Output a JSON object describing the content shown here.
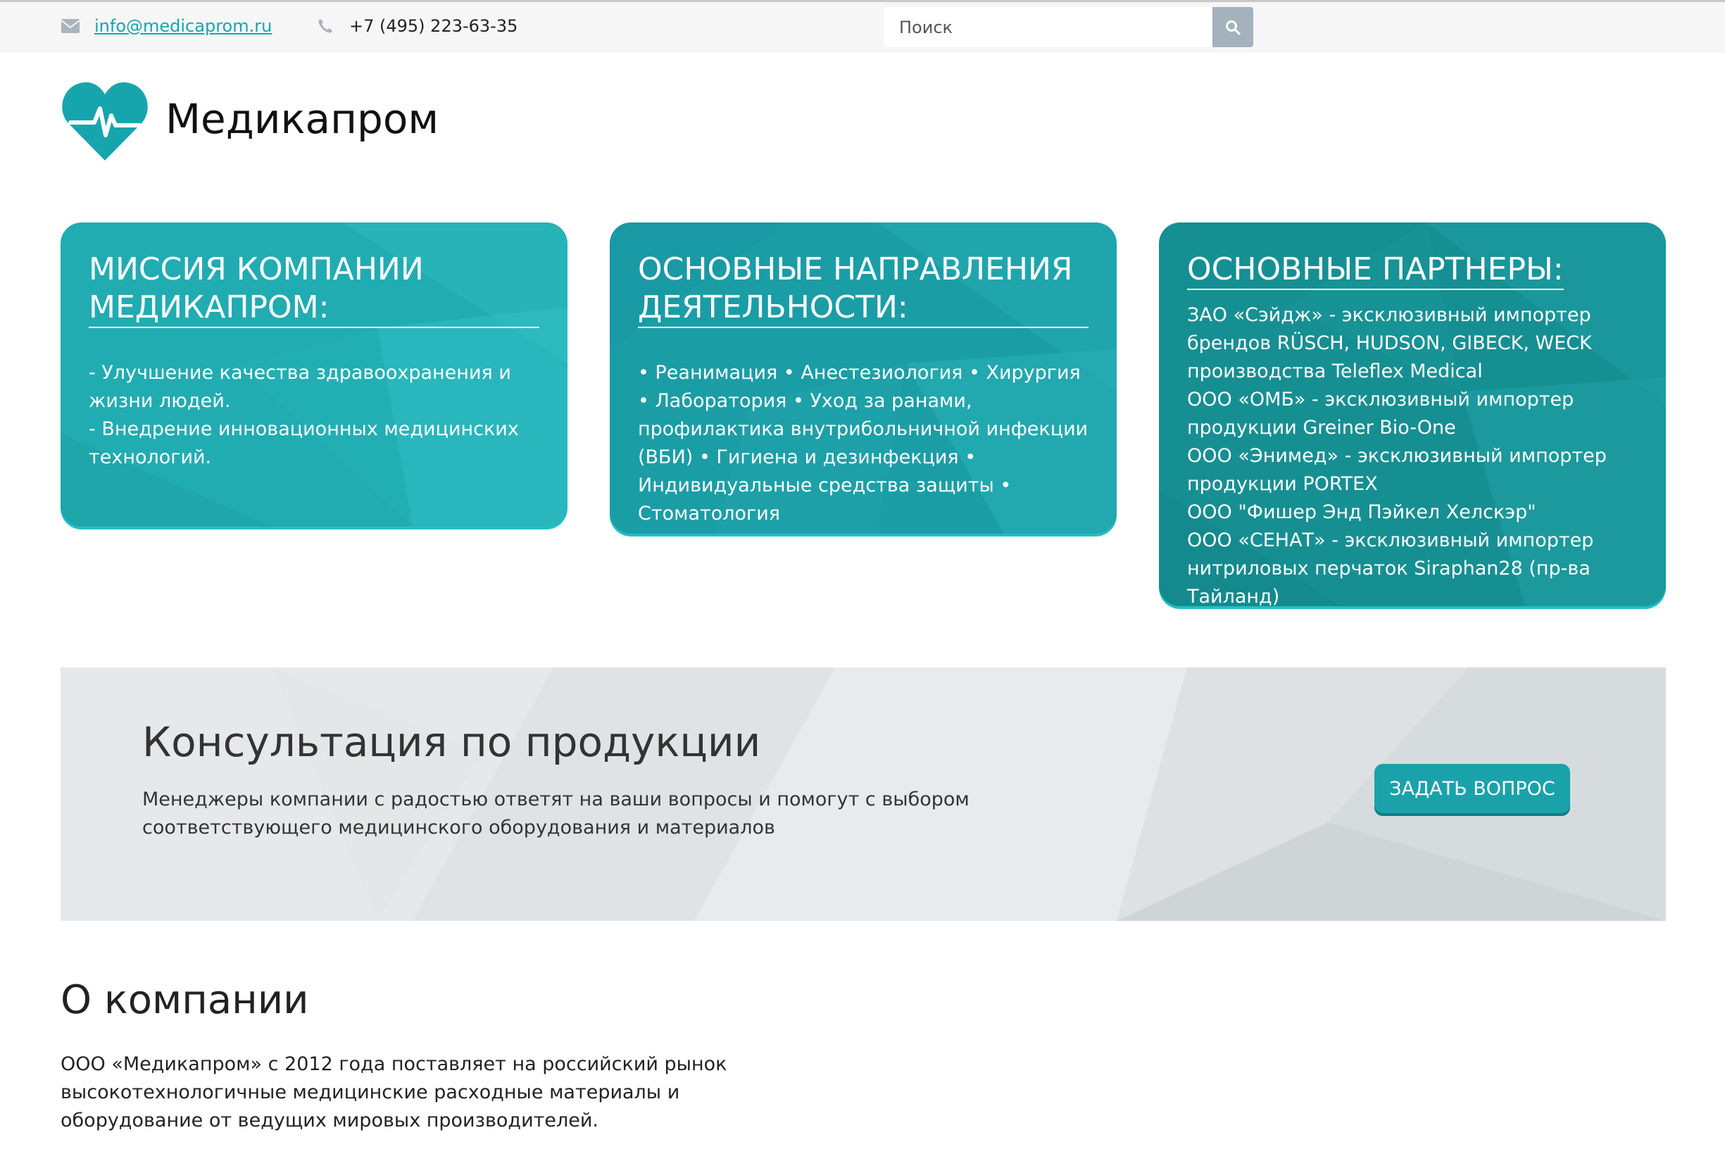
{
  "topbar": {
    "email": "info@medicaprom.ru",
    "email_icon": "envelope-icon",
    "phone": "+7 (495) 223-63-35",
    "phone_icon": "phone-icon",
    "search_placeholder": "Поиск",
    "search_icon": "search-icon"
  },
  "logo": {
    "icon": "heart-pulse-icon",
    "brand": "Медикапром"
  },
  "cards": [
    {
      "title": "МИССИЯ КОМПАНИИ МЕДИКАПРОМ:",
      "text_lines": [
        "- Улучшение качества здравоохранения и жизни людей.",
        "- Внедрение инновационных медицинских технологий."
      ]
    },
    {
      "title": "ОСНОВНЫЕ НАПРАВЛЕНИЯ ДЕЯТЕЛЬНОСТИ:",
      "text": "• Реанимация • Анестезиология • Хирургия • Лаборатория • Уход за ранами, профилактика внутрибольничной инфекции (ВБИ) • Гигиена и дезинфекция • Индивидуальные средства защиты • Стоматология"
    },
    {
      "title": "ОСНОВНЫЕ ПАРТНЕРЫ:",
      "partners": [
        "ЗАО «Сэйдж» - эксклюзивный импортер брендов RÜSCH, HUDSON, GIBECK, WECK производства Teleflex Medical",
        "ООО «ОМБ» - эксклюзивный импортер продукции Greiner Bio-One",
        "ООО «Энимед» - эксклюзивный импортер продукции PORTEX",
        "ООО \"Фишер Энд Пэйкел Хелскэр\"",
        "ООО «СЕНАТ» - эксклюзивный импортер нитриловых перчаток Siraphan28 (пр-ва Тайланд)"
      ]
    }
  ],
  "consult": {
    "title": "Консультация по продукции",
    "text": "Менеджеры компании с радостью ответят на ваши вопросы и помогут с выбором соответствующего медицинского оборудования и материалов",
    "button": "ЗАДАТЬ ВОПРОС"
  },
  "about": {
    "title": "О компании",
    "text": "ООО «Медикапром» с 2012 года поставляет на российский рынок высокотехнологичные медицинские расходные материалы и оборудование от ведущих мировых производителей."
  },
  "colors": {
    "accent": "#1aa2ab",
    "card1": "#21acb1",
    "card2": "#1b9da6",
    "card3": "#168f93",
    "link": "#17a5ad"
  }
}
